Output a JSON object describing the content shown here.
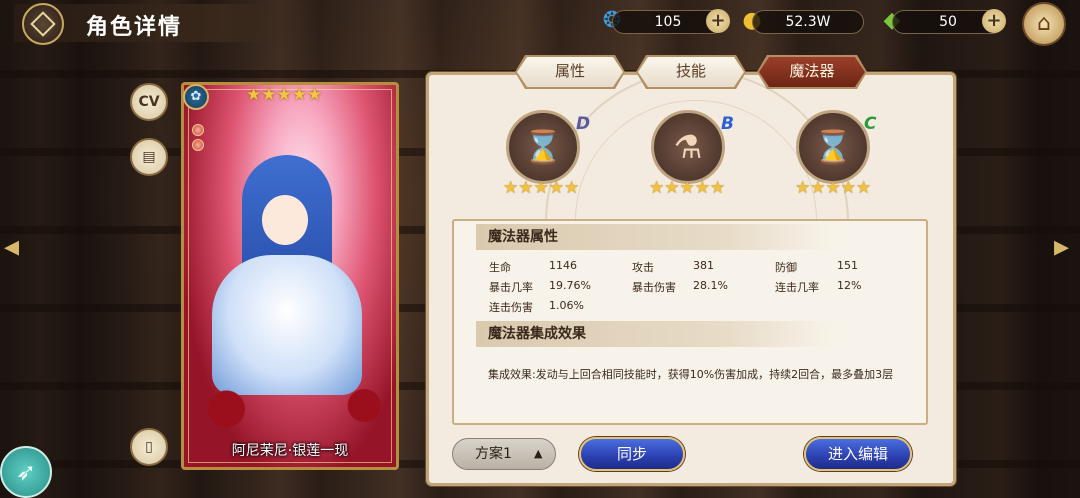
{
  "header": {
    "title": "角色详情",
    "resources": [
      {
        "icon": "shell-icon",
        "value": "105"
      },
      {
        "icon": "coin-icon",
        "value": "52.3W"
      },
      {
        "icon": "crystal-icon",
        "value": "50"
      }
    ],
    "plus_label": "+"
  },
  "side": {
    "cv_label": "CV"
  },
  "card": {
    "name": "阿尼茉尼·银莲一现",
    "stars": "★★★★★"
  },
  "tabs": [
    {
      "label": "属性",
      "active": false
    },
    {
      "label": "技能",
      "active": false
    },
    {
      "label": "魔法器",
      "active": true
    }
  ],
  "artifacts": [
    {
      "icon": "hourglass-icon",
      "glyph": "⌛",
      "grade": "D",
      "grade_color": "#5a5aa0",
      "stars": "★★★★★"
    },
    {
      "icon": "potion-icon",
      "glyph": "⚗",
      "grade": "B",
      "grade_color": "#2f5fd0",
      "stars": "★★★★★"
    },
    {
      "icon": "hourglass-icon",
      "glyph": "⌛",
      "grade": "C",
      "grade_color": "#2f9a3a",
      "stars": "★★★★★"
    }
  ],
  "attributes": {
    "heading": "魔法器属性",
    "rows": [
      {
        "label": "生命",
        "value": "1146"
      },
      {
        "label": "攻击",
        "value": "381"
      },
      {
        "label": "防御",
        "value": "151"
      },
      {
        "label": "暴击几率",
        "value": "19.76%"
      },
      {
        "label": "暴击伤害",
        "value": "28.1%"
      },
      {
        "label": "连击几率",
        "value": "12%"
      },
      {
        "label": "连击伤害",
        "value": "1.06%"
      }
    ]
  },
  "set_effect": {
    "heading": "魔法器集成效果",
    "text": "集成效果:发动与上回合相同技能时，获得10%伤害加成，持续2回合，最多叠加3层"
  },
  "footer": {
    "plan_label": "方案1",
    "sync_label": "同步",
    "edit_label": "进入编辑"
  },
  "colors": {
    "accent_red": "#8a3020",
    "button_blue": "#2b3fb0",
    "gold": "#f2c23e"
  }
}
